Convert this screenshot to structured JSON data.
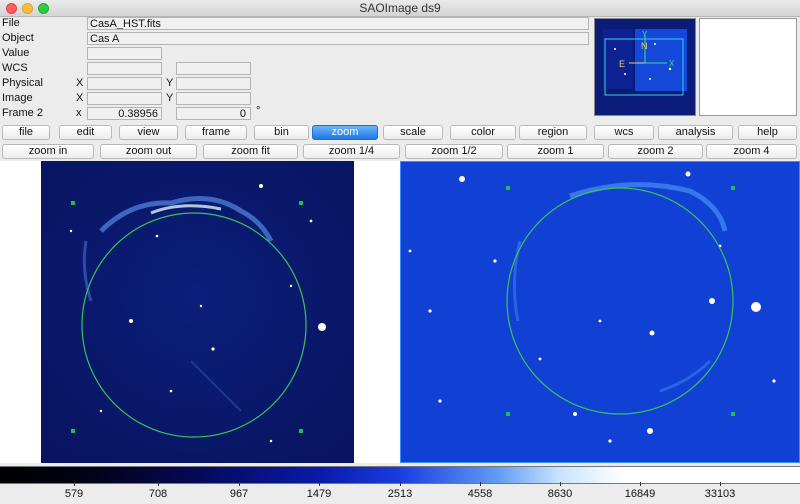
{
  "window": {
    "title": "SAOImage ds9"
  },
  "info": {
    "file": {
      "label": "File",
      "value": "CasA_HST.fits"
    },
    "object": {
      "label": "Object",
      "value": "Cas A"
    },
    "value": {
      "label": "Value"
    },
    "wcs": {
      "label": "WCS"
    },
    "physical": {
      "label": "Physical",
      "x_label": "X",
      "y_label": "Y"
    },
    "image": {
      "label": "Image",
      "x_label": "X",
      "y_label": "Y"
    },
    "frame": {
      "label": "Frame 2",
      "x_label": "x",
      "zoom": "0.38956",
      "angle": "0",
      "degree": "°"
    }
  },
  "panner": {
    "north": "N",
    "east": "E",
    "y_axis": "Y",
    "x_axis": "X"
  },
  "menu_buttons": [
    "file",
    "edit",
    "view",
    "frame",
    "bin",
    "zoom",
    "scale",
    "color",
    "region",
    "wcs",
    "analysis",
    "help"
  ],
  "active_menu": "zoom",
  "zoom_buttons": [
    "zoom in",
    "zoom out",
    "zoom fit",
    "zoom 1/4",
    "zoom 1/2",
    "zoom 1",
    "zoom 2",
    "zoom 4"
  ],
  "colorbar": {
    "ticks": [
      "579",
      "708",
      "967",
      "1479",
      "2513",
      "4558",
      "8630",
      "16849",
      "33103"
    ]
  },
  "colors": {
    "accent": "#2a7ae8",
    "image_bg_left": "#0b1a70",
    "image_bg_right": "#0f3fd6",
    "region_circle": "#3ac25a",
    "region_marker": "#19c24a"
  }
}
